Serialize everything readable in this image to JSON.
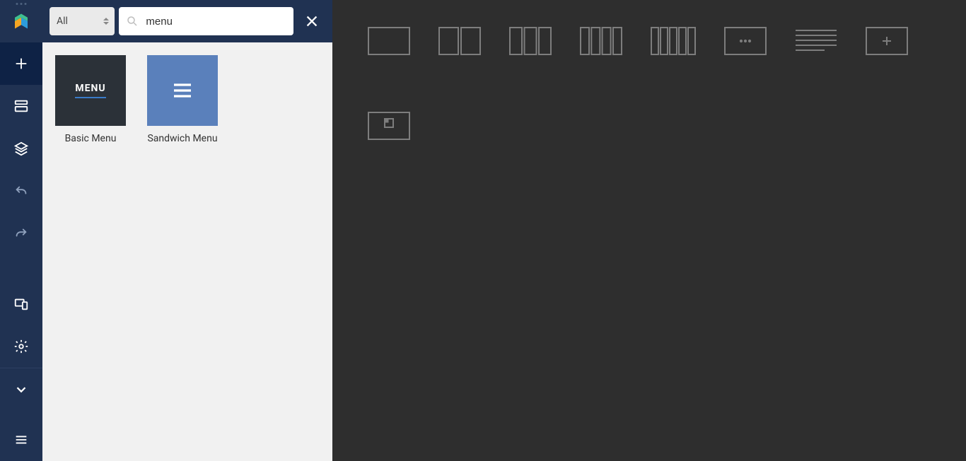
{
  "sidebar": {
    "tools": {
      "add": "Add Element",
      "template": "Templates",
      "layers": "Tree View",
      "undo": "Undo",
      "redo": "Redo",
      "devices": "Responsive",
      "settings": "Settings",
      "publish": "Publish",
      "menu": "Menu"
    }
  },
  "panel": {
    "filter": {
      "selected": "All"
    },
    "search": {
      "value": "menu",
      "placeholder": "Search"
    },
    "elements": [
      {
        "id": "basic-menu",
        "label": "Basic Menu",
        "thumb_text": "MENU"
      },
      {
        "id": "sandwich-menu",
        "label": "Sandwich Menu"
      }
    ]
  },
  "canvas": {
    "layouts": [
      {
        "id": "col-1",
        "cols": 1
      },
      {
        "id": "col-2",
        "cols": 2
      },
      {
        "id": "col-3",
        "cols": 3
      },
      {
        "id": "col-4",
        "cols": 4
      },
      {
        "id": "col-5",
        "cols": 5
      },
      {
        "id": "col-dots",
        "cols": "dots"
      },
      {
        "id": "text-block",
        "cols": "text"
      },
      {
        "id": "add-block",
        "cols": "plus"
      },
      {
        "id": "save",
        "cols": "save"
      }
    ]
  },
  "colors": {
    "sidebar_bg": "#203252",
    "sidebar_active": "#0e2245",
    "panel_bg": "#f1f1f1",
    "canvas_bg": "#2e2e2e",
    "accent_blue": "#5a80bb",
    "thumb_dark": "#2b3138"
  }
}
